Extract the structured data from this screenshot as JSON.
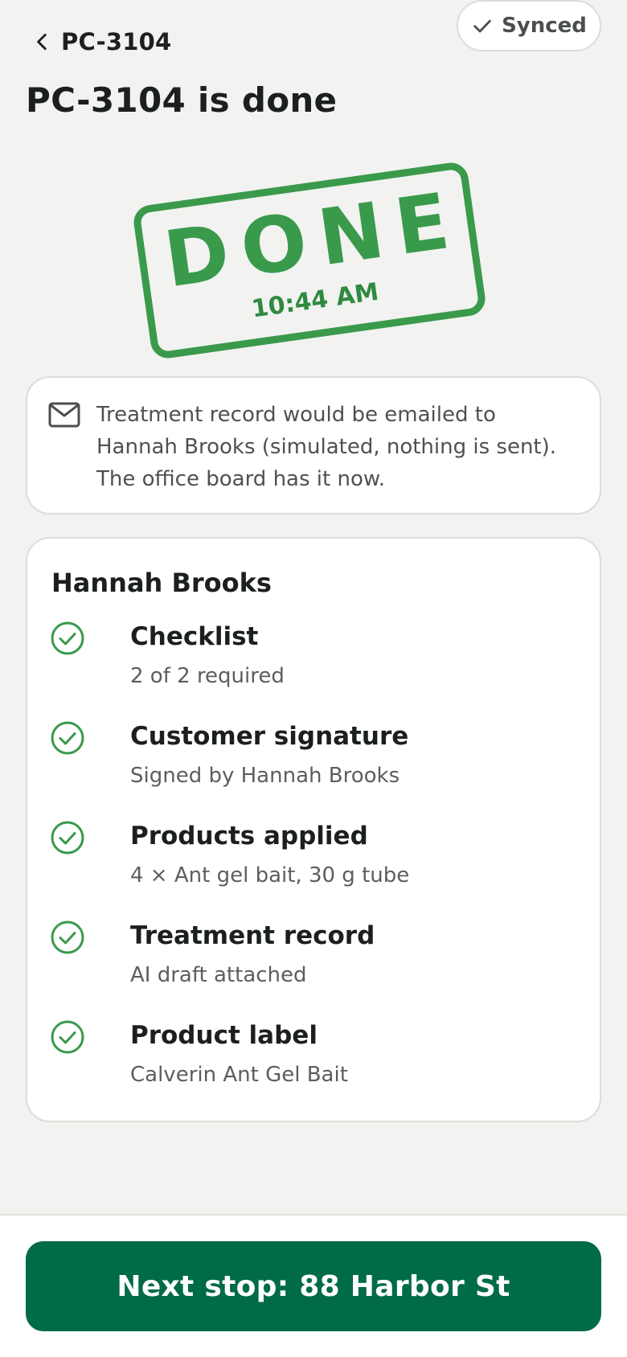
{
  "header": {
    "back_label": "PC-3104",
    "sync_status": "Synced"
  },
  "title": "PC-3104 is done",
  "stamp": {
    "word": "DONE",
    "time": "10:44 AM"
  },
  "notice": {
    "icon": "mail-icon",
    "text": "Treatment record would be emailed to Hannah Brooks (simulated, nothing is sent). The office board has it now."
  },
  "summary": {
    "customer": "Hannah Brooks",
    "items": [
      {
        "title": "Checklist",
        "subtitle": "2 of 2 required",
        "icon": "check-circle-icon"
      },
      {
        "title": "Customer signature",
        "subtitle": "Signed by Hannah Brooks",
        "icon": "check-circle-icon"
      },
      {
        "title": "Products applied",
        "subtitle": "4 × Ant gel bait, 30 g tube",
        "icon": "check-circle-icon"
      },
      {
        "title": "Treatment record",
        "subtitle": "AI draft attached",
        "icon": "check-circle-icon"
      },
      {
        "title": "Product label",
        "subtitle": "Calverin Ant Gel Bait",
        "icon": "check-circle-icon"
      }
    ]
  },
  "footer": {
    "next_label": "Next stop: 88 Harbor St"
  },
  "colors": {
    "accent": "#006b47",
    "stamp_green": "#3a9a4b",
    "background": "#f2f2f1"
  }
}
